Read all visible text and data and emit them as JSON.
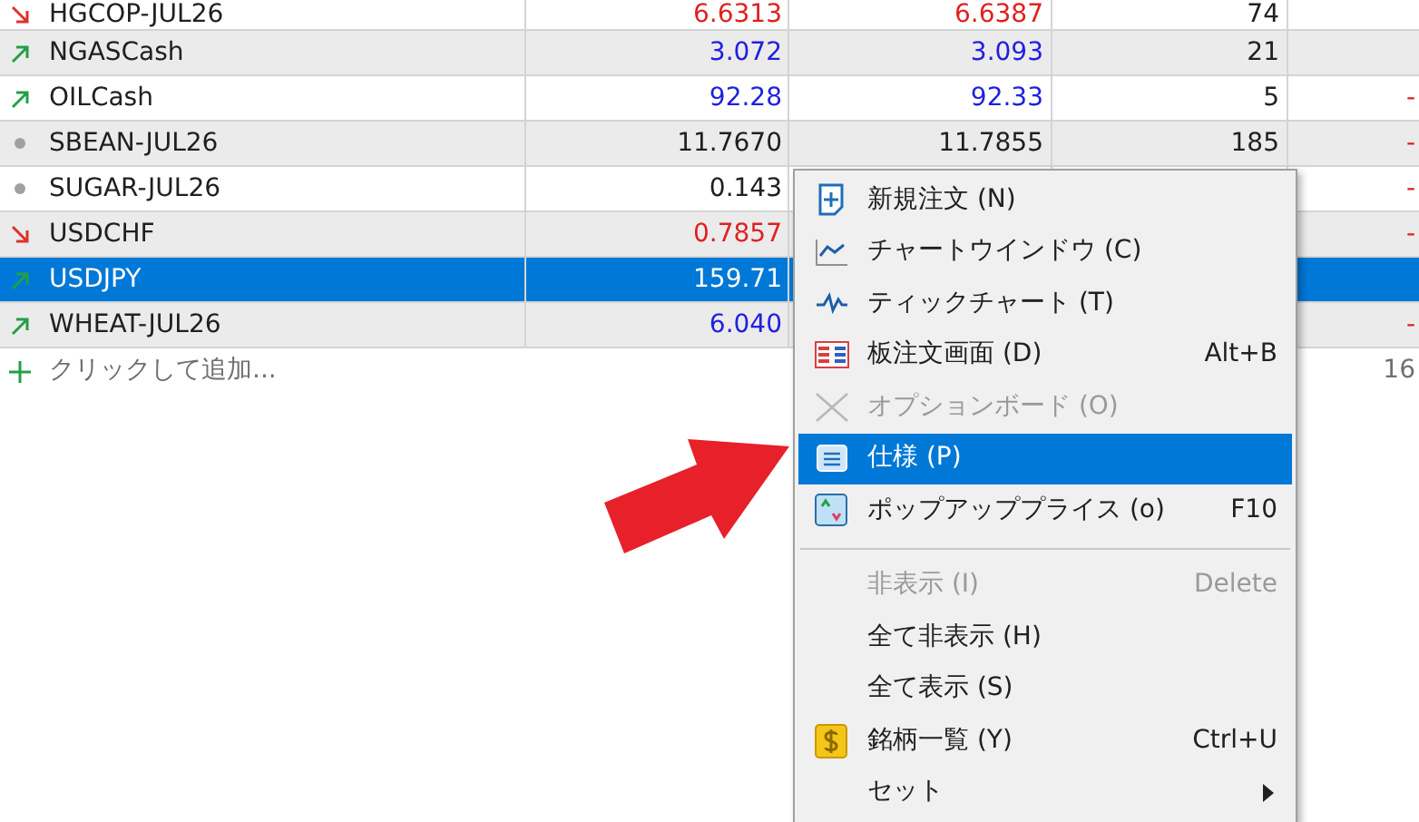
{
  "table": {
    "rows": [
      {
        "symbol": "HGCOP-JUL26",
        "kind": "down",
        "bid": "6.6313",
        "ask": "6.6387",
        "spread": "74",
        "selected": false
      },
      {
        "symbol": "NGASCash",
        "kind": "up",
        "bid": "3.072",
        "ask": "3.093",
        "spread": "21",
        "selected": false
      },
      {
        "symbol": "OILCash",
        "kind": "up",
        "bid": "92.28",
        "ask": "92.33",
        "spread": "5",
        "column_5": "-",
        "selected": false
      },
      {
        "symbol": "SBEAN-JUL26",
        "kind": "flat",
        "bid": "11.7670",
        "ask": "11.7855",
        "spread": "185",
        "column_5": "-",
        "selected": false
      },
      {
        "symbol": "SUGAR-JUL26",
        "kind": "flat",
        "bid": "0.143",
        "column_5": "-",
        "selected": false
      },
      {
        "symbol": "USDCHF",
        "kind": "down",
        "bid": "0.7857",
        "column_5": "-",
        "selected": false
      },
      {
        "symbol": "USDJPY",
        "kind": "up",
        "bid": "159.71",
        "selected": true
      },
      {
        "symbol": "WHEAT-JUL26",
        "kind": "up",
        "bid": "6.040",
        "column_5": "-",
        "selected": false
      }
    ],
    "add_row": {
      "label": "クリックして追加...",
      "count": "16"
    }
  },
  "context_menu": {
    "items": [
      {
        "kind": "order",
        "label": "新規注文 (N)",
        "disabled": false,
        "selected": false
      },
      {
        "kind": "chart",
        "label": "チャートウインドウ (C)",
        "disabled": false,
        "selected": false
      },
      {
        "kind": "tick",
        "label": "ティックチャート (T)",
        "disabled": false,
        "selected": false
      },
      {
        "kind": "board",
        "label": "板注文画面 (D)",
        "shortcut": "Alt+B",
        "disabled": false,
        "selected": false
      },
      {
        "kind": "option",
        "label": "オプションボード (O)",
        "disabled": true,
        "selected": false
      },
      {
        "kind": "spec",
        "label": "仕様 (P)",
        "disabled": false,
        "selected": true
      },
      {
        "kind": "popup",
        "label": "ポップアッププライス (o)",
        "shortcut": "F10",
        "disabled": false,
        "selected": false
      },
      {
        "kind": "separator"
      },
      {
        "kind": "plain",
        "label": "非表示 (I)",
        "shortcut": "Delete",
        "disabled": true,
        "selected": false
      },
      {
        "kind": "plain",
        "label": "全て非表示 (H)",
        "disabled": false,
        "selected": false
      },
      {
        "kind": "plain",
        "label": "全て表示 (S)",
        "disabled": false,
        "selected": false
      },
      {
        "kind": "symbols",
        "label": "銘柄一覧 (Y)",
        "shortcut": "Ctrl+U",
        "disabled": false,
        "selected": false
      },
      {
        "kind": "submenu",
        "label": "セット",
        "disabled": false,
        "selected": false
      }
    ]
  }
}
